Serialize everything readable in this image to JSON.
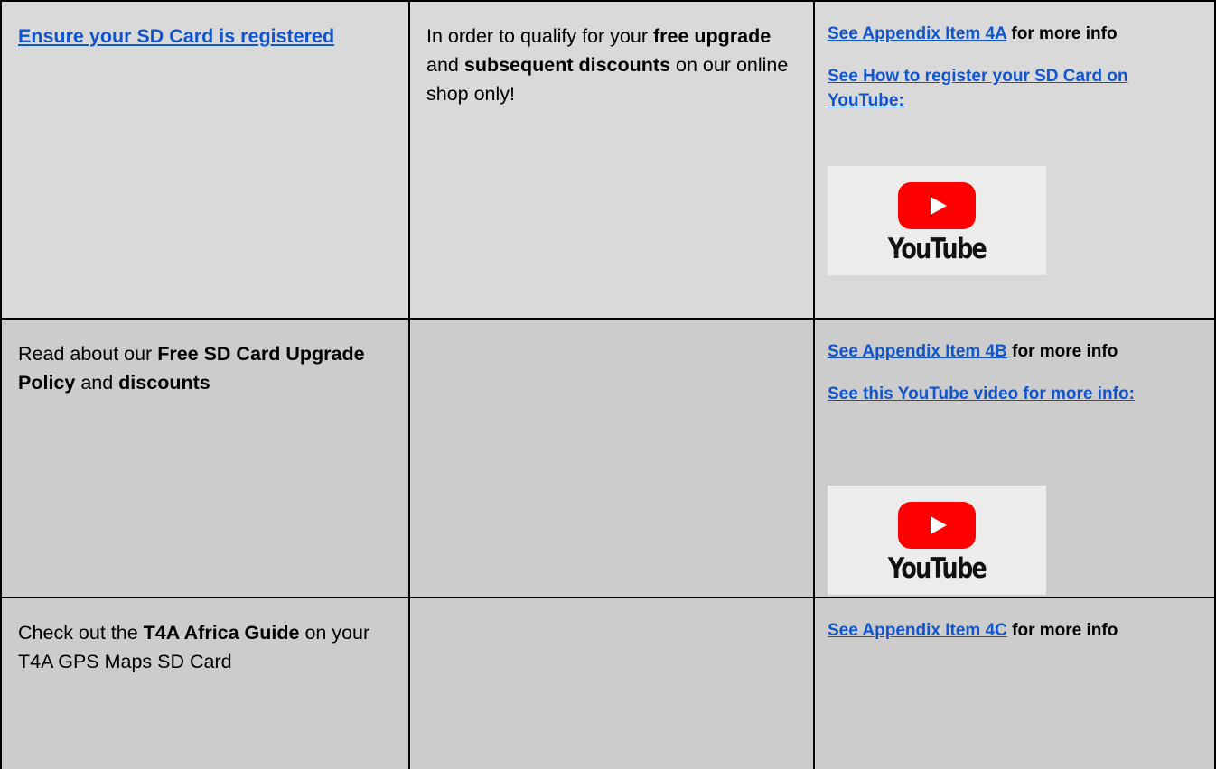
{
  "row1": {
    "col1": {
      "link": "Ensure your SD Card is registered"
    },
    "col2": {
      "t1": "In order to qualify for your ",
      "b1": "free upgrade",
      "t2": " and ",
      "b2": "subsequent discounts",
      "t3": " on our online shop only!"
    },
    "col3": {
      "link1": "See Appendix Item 4A",
      "after1": " for more info",
      "link2": "See How to register your SD Card on YouTube:",
      "thumb_word": "YouTube",
      "thumb_icon": "youtube-play-icon"
    }
  },
  "row2": {
    "col1": {
      "t1": "Read about our ",
      "b1": "Free SD Card Upgrade Policy",
      "t2": " and ",
      "b2": "discounts"
    },
    "col3": {
      "link1": "See Appendix Item 4B",
      "after1": " for more info",
      "link2": "See this YouTube video for more info:",
      "thumb_word": "YouTube",
      "thumb_icon": "youtube-play-icon"
    }
  },
  "row3": {
    "col1": {
      "t1": "Check out the ",
      "b1": "T4A Africa Guide",
      "t2": " on your T4A GPS Maps SD Card"
    },
    "col3": {
      "link1": "See Appendix Item 4C",
      "after1": " for more info"
    }
  },
  "colors": {
    "link": "#1155cc",
    "row1_bg": "#d9d9d9",
    "row_bg": "#cccccc",
    "youtube_red": "#ff0000"
  }
}
